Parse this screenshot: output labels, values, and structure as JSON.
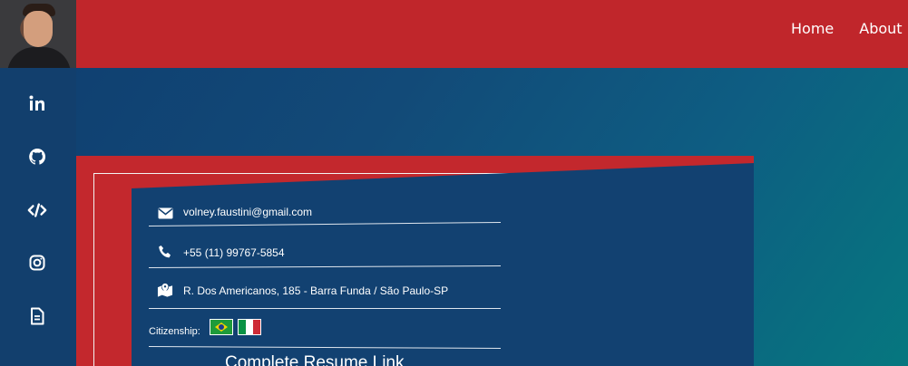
{
  "header": {
    "avatar_alt": "profile photo",
    "nav": [
      {
        "label": "Home"
      },
      {
        "label": "About"
      }
    ],
    "bg_color": "#c0262b"
  },
  "sidebar": {
    "icons": [
      "linkedin-icon",
      "github-icon",
      "code-icon",
      "instagram-icon",
      "document-icon"
    ]
  },
  "contact": {
    "email": "volney.faustini@gmail.com",
    "phone": "+55 (11) 99767-5854",
    "address": "R. Dos Americanos, 185 - Barra Funda / São Paulo-SP",
    "citizenship_label": "Citizenship:",
    "flags": [
      "brazil-flag",
      "italy-flag"
    ],
    "resume_link": "Complete Resume Link"
  },
  "colors": {
    "accent_red": "#c0262b",
    "panel_blue": "#124171"
  }
}
